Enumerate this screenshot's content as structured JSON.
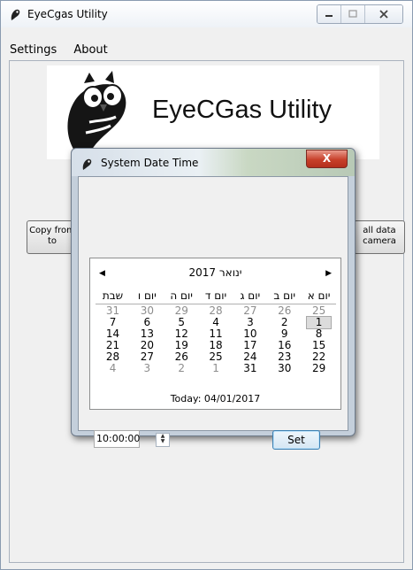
{
  "window": {
    "title": "EyeCgas Utility",
    "icon": "bird-logo-icon"
  },
  "menu": {
    "items": [
      "Settings",
      "About"
    ]
  },
  "logo": {
    "text": "EyeCGas Utility",
    "image": "owl-logo"
  },
  "buttons": {
    "left_label": "Copy from\nto",
    "right_label": "all data\ncamera"
  },
  "dialog": {
    "title": "System Date Time",
    "close_label": "X",
    "calendar": {
      "month_label": "ינואר 2017",
      "prev_icon": "left-arrow-icon",
      "next_icon": "right-arrow-icon",
      "days_of_week": [
        "יום א",
        "יום ב",
        "יום ג",
        "יום ד",
        "יום ה",
        "יום ו",
        "שבת"
      ],
      "weeks": [
        [
          "25",
          "26",
          "27",
          "28",
          "29",
          "30",
          "31"
        ],
        [
          "1",
          "2",
          "3",
          "4",
          "5",
          "6",
          "7"
        ],
        [
          "8",
          "9",
          "10",
          "11",
          "12",
          "13",
          "14"
        ],
        [
          "15",
          "16",
          "17",
          "18",
          "19",
          "20",
          "21"
        ],
        [
          "22",
          "23",
          "24",
          "25",
          "26",
          "27",
          "28"
        ],
        [
          "29",
          "30",
          "31",
          "1",
          "2",
          "3",
          "4"
        ]
      ],
      "selected_day": "1",
      "today_label": "Today: 04/01/2017"
    },
    "time_value": "10:00:00",
    "set_label": "Set"
  }
}
